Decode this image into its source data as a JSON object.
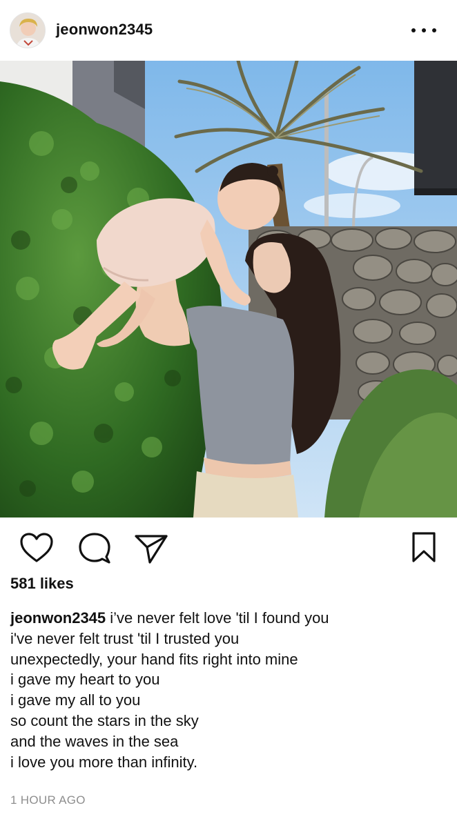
{
  "header": {
    "username": "jeonwon2345",
    "more_icon": "more-horizontal-icon"
  },
  "photo": {
    "description_hint": "photo-post",
    "colors": {
      "sky": "#8cc3ef",
      "foliage": "#3f7f2e",
      "wall": "#7b766e"
    }
  },
  "actions": {
    "like_icon": "heart-icon",
    "comment_icon": "comment-icon",
    "share_icon": "send-icon",
    "save_icon": "bookmark-icon"
  },
  "likes_text": "581 likes",
  "caption": {
    "username": "jeonwon2345",
    "first_line": "i’ve never felt love 'til I found you",
    "lines": [
      "i've never felt trust 'til I trusted you",
      "unexpectedly, your hand fits right into mine",
      "i gave my heart to you",
      "i gave my all to you",
      "so count the stars in the sky",
      "and the waves in the sea",
      "i love you more than infinity."
    ]
  },
  "timestamp": "1 HOUR AGO"
}
